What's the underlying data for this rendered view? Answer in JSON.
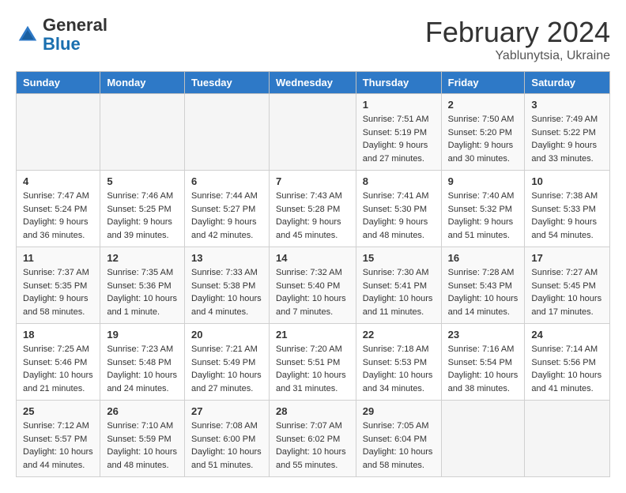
{
  "header": {
    "logo": {
      "general": "General",
      "blue": "Blue"
    },
    "title": "February 2024",
    "subtitle": "Yablunytsia, Ukraine"
  },
  "weekdays": [
    "Sunday",
    "Monday",
    "Tuesday",
    "Wednesday",
    "Thursday",
    "Friday",
    "Saturday"
  ],
  "weeks": [
    [
      {
        "day": "",
        "sunrise": "",
        "sunset": "",
        "daylight": ""
      },
      {
        "day": "",
        "sunrise": "",
        "sunset": "",
        "daylight": ""
      },
      {
        "day": "",
        "sunrise": "",
        "sunset": "",
        "daylight": ""
      },
      {
        "day": "",
        "sunrise": "",
        "sunset": "",
        "daylight": ""
      },
      {
        "day": "1",
        "sunrise": "Sunrise: 7:51 AM",
        "sunset": "Sunset: 5:19 PM",
        "daylight": "Daylight: 9 hours and 27 minutes."
      },
      {
        "day": "2",
        "sunrise": "Sunrise: 7:50 AM",
        "sunset": "Sunset: 5:20 PM",
        "daylight": "Daylight: 9 hours and 30 minutes."
      },
      {
        "day": "3",
        "sunrise": "Sunrise: 7:49 AM",
        "sunset": "Sunset: 5:22 PM",
        "daylight": "Daylight: 9 hours and 33 minutes."
      }
    ],
    [
      {
        "day": "4",
        "sunrise": "Sunrise: 7:47 AM",
        "sunset": "Sunset: 5:24 PM",
        "daylight": "Daylight: 9 hours and 36 minutes."
      },
      {
        "day": "5",
        "sunrise": "Sunrise: 7:46 AM",
        "sunset": "Sunset: 5:25 PM",
        "daylight": "Daylight: 9 hours and 39 minutes."
      },
      {
        "day": "6",
        "sunrise": "Sunrise: 7:44 AM",
        "sunset": "Sunset: 5:27 PM",
        "daylight": "Daylight: 9 hours and 42 minutes."
      },
      {
        "day": "7",
        "sunrise": "Sunrise: 7:43 AM",
        "sunset": "Sunset: 5:28 PM",
        "daylight": "Daylight: 9 hours and 45 minutes."
      },
      {
        "day": "8",
        "sunrise": "Sunrise: 7:41 AM",
        "sunset": "Sunset: 5:30 PM",
        "daylight": "Daylight: 9 hours and 48 minutes."
      },
      {
        "day": "9",
        "sunrise": "Sunrise: 7:40 AM",
        "sunset": "Sunset: 5:32 PM",
        "daylight": "Daylight: 9 hours and 51 minutes."
      },
      {
        "day": "10",
        "sunrise": "Sunrise: 7:38 AM",
        "sunset": "Sunset: 5:33 PM",
        "daylight": "Daylight: 9 hours and 54 minutes."
      }
    ],
    [
      {
        "day": "11",
        "sunrise": "Sunrise: 7:37 AM",
        "sunset": "Sunset: 5:35 PM",
        "daylight": "Daylight: 9 hours and 58 minutes."
      },
      {
        "day": "12",
        "sunrise": "Sunrise: 7:35 AM",
        "sunset": "Sunset: 5:36 PM",
        "daylight": "Daylight: 10 hours and 1 minute."
      },
      {
        "day": "13",
        "sunrise": "Sunrise: 7:33 AM",
        "sunset": "Sunset: 5:38 PM",
        "daylight": "Daylight: 10 hours and 4 minutes."
      },
      {
        "day": "14",
        "sunrise": "Sunrise: 7:32 AM",
        "sunset": "Sunset: 5:40 PM",
        "daylight": "Daylight: 10 hours and 7 minutes."
      },
      {
        "day": "15",
        "sunrise": "Sunrise: 7:30 AM",
        "sunset": "Sunset: 5:41 PM",
        "daylight": "Daylight: 10 hours and 11 minutes."
      },
      {
        "day": "16",
        "sunrise": "Sunrise: 7:28 AM",
        "sunset": "Sunset: 5:43 PM",
        "daylight": "Daylight: 10 hours and 14 minutes."
      },
      {
        "day": "17",
        "sunrise": "Sunrise: 7:27 AM",
        "sunset": "Sunset: 5:45 PM",
        "daylight": "Daylight: 10 hours and 17 minutes."
      }
    ],
    [
      {
        "day": "18",
        "sunrise": "Sunrise: 7:25 AM",
        "sunset": "Sunset: 5:46 PM",
        "daylight": "Daylight: 10 hours and 21 minutes."
      },
      {
        "day": "19",
        "sunrise": "Sunrise: 7:23 AM",
        "sunset": "Sunset: 5:48 PM",
        "daylight": "Daylight: 10 hours and 24 minutes."
      },
      {
        "day": "20",
        "sunrise": "Sunrise: 7:21 AM",
        "sunset": "Sunset: 5:49 PM",
        "daylight": "Daylight: 10 hours and 27 minutes."
      },
      {
        "day": "21",
        "sunrise": "Sunrise: 7:20 AM",
        "sunset": "Sunset: 5:51 PM",
        "daylight": "Daylight: 10 hours and 31 minutes."
      },
      {
        "day": "22",
        "sunrise": "Sunrise: 7:18 AM",
        "sunset": "Sunset: 5:53 PM",
        "daylight": "Daylight: 10 hours and 34 minutes."
      },
      {
        "day": "23",
        "sunrise": "Sunrise: 7:16 AM",
        "sunset": "Sunset: 5:54 PM",
        "daylight": "Daylight: 10 hours and 38 minutes."
      },
      {
        "day": "24",
        "sunrise": "Sunrise: 7:14 AM",
        "sunset": "Sunset: 5:56 PM",
        "daylight": "Daylight: 10 hours and 41 minutes."
      }
    ],
    [
      {
        "day": "25",
        "sunrise": "Sunrise: 7:12 AM",
        "sunset": "Sunset: 5:57 PM",
        "daylight": "Daylight: 10 hours and 44 minutes."
      },
      {
        "day": "26",
        "sunrise": "Sunrise: 7:10 AM",
        "sunset": "Sunset: 5:59 PM",
        "daylight": "Daylight: 10 hours and 48 minutes."
      },
      {
        "day": "27",
        "sunrise": "Sunrise: 7:08 AM",
        "sunset": "Sunset: 6:00 PM",
        "daylight": "Daylight: 10 hours and 51 minutes."
      },
      {
        "day": "28",
        "sunrise": "Sunrise: 7:07 AM",
        "sunset": "Sunset: 6:02 PM",
        "daylight": "Daylight: 10 hours and 55 minutes."
      },
      {
        "day": "29",
        "sunrise": "Sunrise: 7:05 AM",
        "sunset": "Sunset: 6:04 PM",
        "daylight": "Daylight: 10 hours and 58 minutes."
      },
      {
        "day": "",
        "sunrise": "",
        "sunset": "",
        "daylight": ""
      },
      {
        "day": "",
        "sunrise": "",
        "sunset": "",
        "daylight": ""
      }
    ]
  ]
}
